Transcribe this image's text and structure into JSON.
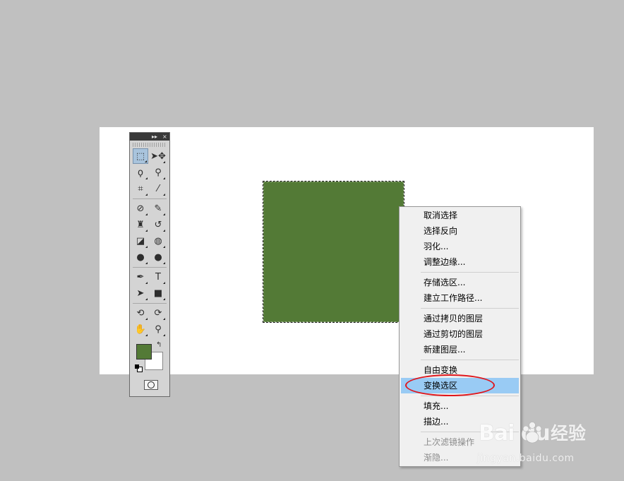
{
  "toolbox": {
    "titlebar": {
      "collapse_glyph": "▸▸",
      "close_glyph": "×"
    },
    "tools": [
      [
        {
          "name": "rect-marquee-tool",
          "icon": "dashed-rectangle",
          "glyph": "⬚",
          "active": true
        },
        {
          "name": "move-tool",
          "icon": "arrow-move",
          "glyph": "➤✥"
        }
      ],
      [
        {
          "name": "lasso-tool",
          "icon": "lasso",
          "glyph": "ϙ"
        },
        {
          "name": "quick-selection-tool",
          "icon": "brush-dotted",
          "glyph": "⚲"
        }
      ],
      [
        {
          "name": "crop-tool",
          "icon": "crop",
          "glyph": "⌗"
        },
        {
          "name": "eyedropper-tool",
          "icon": "eyedropper",
          "glyph": "⁄"
        }
      ],
      [
        {
          "name": "healing-brush-tool",
          "icon": "bandage",
          "glyph": "⊘"
        },
        {
          "name": "brush-tool",
          "icon": "brush",
          "glyph": "✎"
        }
      ],
      [
        {
          "name": "clone-stamp-tool",
          "icon": "stamp",
          "glyph": "♜"
        },
        {
          "name": "history-brush-tool",
          "icon": "history-brush",
          "glyph": "↺"
        }
      ],
      [
        {
          "name": "eraser-tool",
          "icon": "eraser",
          "glyph": "◪"
        },
        {
          "name": "paint-bucket-tool",
          "icon": "bucket",
          "glyph": "◍"
        }
      ],
      [
        {
          "name": "blur-tool",
          "icon": "drop",
          "glyph": "●"
        },
        {
          "name": "dodge-tool",
          "icon": "magnifier-dark",
          "glyph": "●"
        }
      ],
      [
        {
          "name": "pen-tool",
          "icon": "pen",
          "glyph": "✒"
        },
        {
          "name": "type-tool",
          "icon": "type-T",
          "glyph": "T"
        }
      ],
      [
        {
          "name": "path-selection-tool",
          "icon": "arrow-black",
          "glyph": "➤"
        },
        {
          "name": "rectangle-shape-tool",
          "icon": "rectangle",
          "glyph": "■"
        }
      ],
      [
        {
          "name": "3d-rotate-tool",
          "icon": "3d-rotate",
          "glyph": "⟲"
        },
        {
          "name": "3d-orbit-tool",
          "icon": "3d-orbit",
          "glyph": "⟳"
        }
      ],
      [
        {
          "name": "hand-tool",
          "icon": "hand",
          "glyph": "✋"
        },
        {
          "name": "zoom-tool",
          "icon": "magnifier",
          "glyph": "⚲"
        }
      ]
    ],
    "swatches": {
      "foreground": "#537a36",
      "background": "#ffffff",
      "swap_glyph": "↰"
    }
  },
  "canvas": {
    "background": "#ffffff",
    "shape_fill": "#537a36"
  },
  "context_menu": {
    "groups": [
      [
        "取消选择",
        "选择反向",
        "羽化...",
        "调整边缘..."
      ],
      [
        "存储选区...",
        "建立工作路径..."
      ],
      [
        "通过拷贝的图层",
        "通过剪切的图层",
        "新建图层..."
      ],
      [
        "自由变换",
        "变换选区"
      ],
      [
        "填充...",
        "描边..."
      ],
      [
        "上次滤镜操作",
        "渐隐..."
      ]
    ],
    "highlighted": "变换选区",
    "disabled": [
      "上次滤镜操作",
      "渐隐..."
    ],
    "highlight_color": "#99cbf4",
    "annotation_color": "#e0161b"
  },
  "watermark": {
    "logo_text": "Bai du",
    "brand_text": "经验",
    "url": "jingyan.baidu.com"
  }
}
